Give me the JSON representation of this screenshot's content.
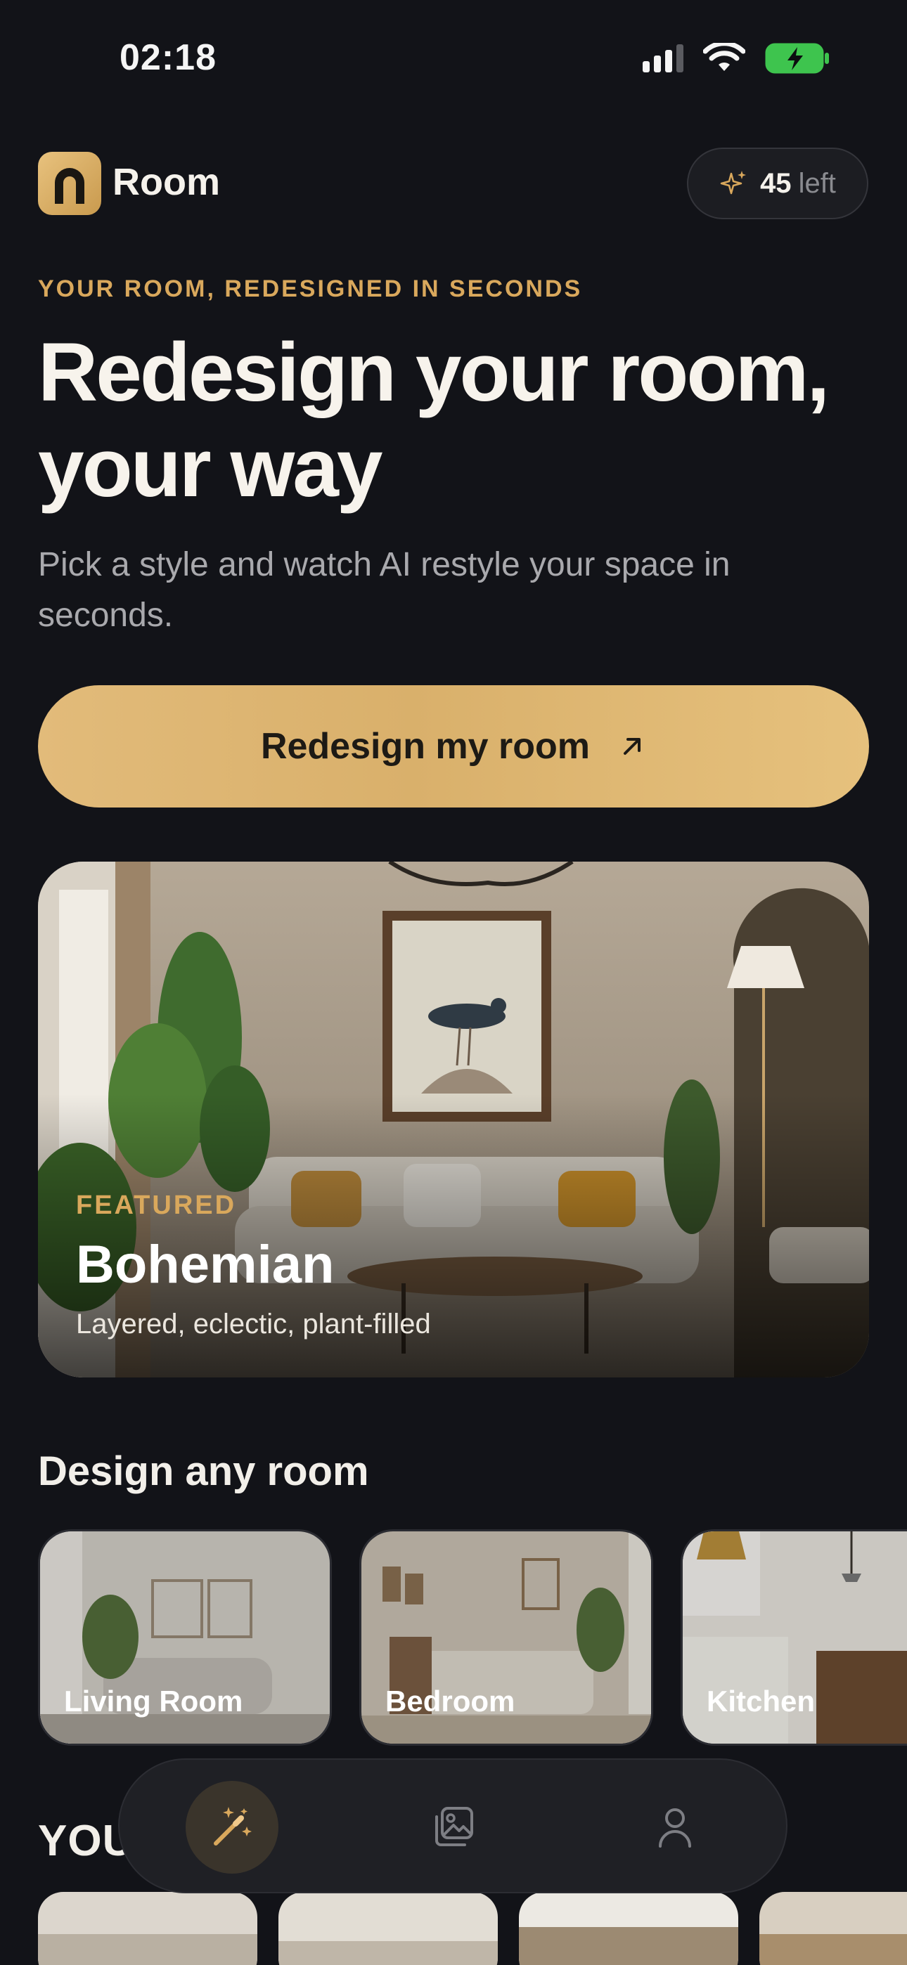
{
  "status_bar": {
    "time": "02:18"
  },
  "header": {
    "app_name": "Room",
    "credits": {
      "count": "45",
      "label": "left"
    }
  },
  "hero": {
    "kicker": "YOUR ROOM, REDESIGNED IN SECONDS",
    "headline_line1": "Redesign your room,",
    "headline_line2": "your way",
    "subtext": "Pick a style and watch AI restyle your space in seconds.",
    "cta_label": "Redesign my room"
  },
  "featured": {
    "kicker": "FEATURED",
    "title": "Bohemian",
    "subtitle": "Layered, eclectic, plant-filled"
  },
  "rooms_section": {
    "title": "Design any room",
    "rooms": [
      {
        "label": "Living Room"
      },
      {
        "label": "Bedroom"
      },
      {
        "label": "Kitchen"
      }
    ]
  },
  "second_section": {
    "title_partial": "YOU"
  },
  "tab_bar": {
    "tabs": [
      {
        "icon": "magic-wand-icon",
        "active": true
      },
      {
        "icon": "gallery-icon",
        "active": false
      },
      {
        "icon": "profile-icon",
        "active": false
      }
    ]
  },
  "colors": {
    "background": "#121318",
    "accent_gold": "#d9a85c",
    "cta_gold": "#e2bb7a",
    "battery_green": "#3ec44e"
  }
}
